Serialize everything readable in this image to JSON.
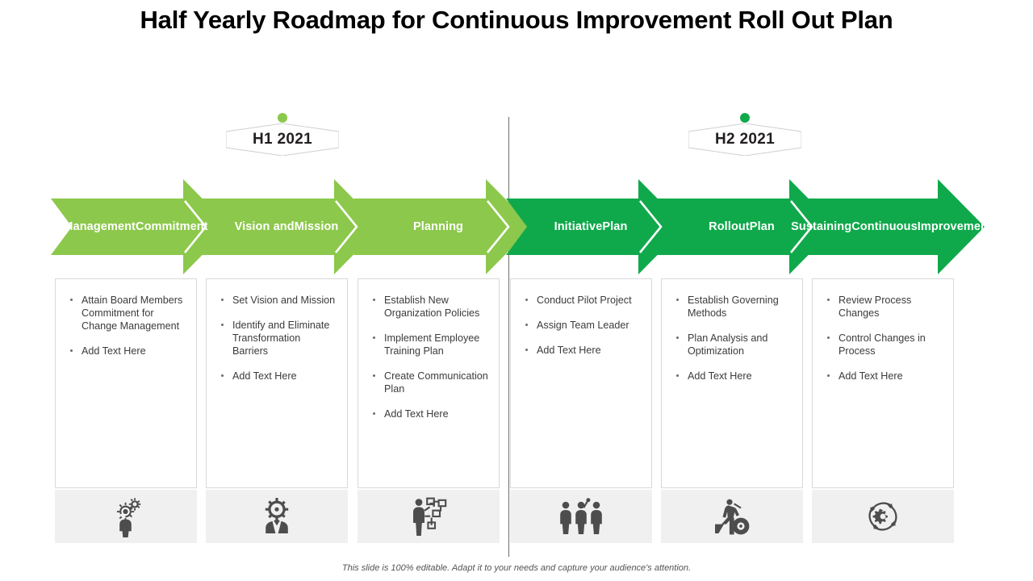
{
  "title": "Half Yearly Roadmap for Continuous Improvement Roll Out Plan",
  "footer": "This slide is 100% editable. Adapt it to your needs and capture your audience's attention.",
  "colors": {
    "phase1": "#8CC84B",
    "phase2": "#0FA94B",
    "divider": "#6E6E6E",
    "card_border": "#D9D9D9",
    "icon_panel": "#F0F0F0",
    "icon_glyph": "#4D4D4D",
    "title_text": "#000000"
  },
  "periods": [
    {
      "label": "H1 2021",
      "dot_color": "#8CC84B"
    },
    {
      "label": "H2 2021",
      "dot_color": "#0FA94B"
    }
  ],
  "stages": [
    {
      "name": "Management Commitment",
      "label_lines": [
        "Management",
        "Commitment"
      ],
      "color": "#8CC84B",
      "period": "H1 2021",
      "icon": "person-gears-icon",
      "bullets": [
        "Attain Board Members Commitment for Change Management",
        "Add Text Here"
      ]
    },
    {
      "name": "Vision and Mission",
      "label_lines": [
        "Vision and",
        "Mission"
      ],
      "color": "#8CC84B",
      "period": "H1 2021",
      "icon": "person-vision-gear-icon",
      "bullets": [
        "Set Vision and Mission",
        "Identify and Eliminate Transformation Barriers",
        "Add Text Here"
      ]
    },
    {
      "name": "Planning",
      "label_lines": [
        "Planning"
      ],
      "color": "#8CC84B",
      "period": "H1 2021",
      "icon": "person-flowchart-icon",
      "bullets": [
        "Establish New Organization Policies",
        "Implement Employee Training Plan",
        "Create Communication Plan",
        "Add Text Here"
      ]
    },
    {
      "name": "Initiative Plan",
      "label_lines": [
        "Initiative",
        "Plan"
      ],
      "color": "#0FA94B",
      "period": "H2 2021",
      "icon": "three-people-team-icon",
      "bullets": [
        "Conduct Pilot Project",
        "Assign Team Leader",
        "Add Text Here"
      ]
    },
    {
      "name": "Rollout Plan",
      "label_lines": [
        "Rollout",
        "Plan"
      ],
      "color": "#0FA94B",
      "period": "H2 2021",
      "icon": "person-roller-icon",
      "bullets": [
        "Establish Governing Methods",
        "Plan Analysis and Optimization",
        "Add Text Here"
      ]
    },
    {
      "name": "Sustaining Continuous Improvement",
      "label_lines": [
        "Sustaining",
        "Continuous",
        "Improvement"
      ],
      "color": "#0FA94B",
      "period": "H2 2021",
      "icon": "gear-cycle-arrows-icon",
      "bullets": [
        "Review Process Changes",
        "Control Changes in Process",
        "Add Text Here"
      ]
    }
  ]
}
